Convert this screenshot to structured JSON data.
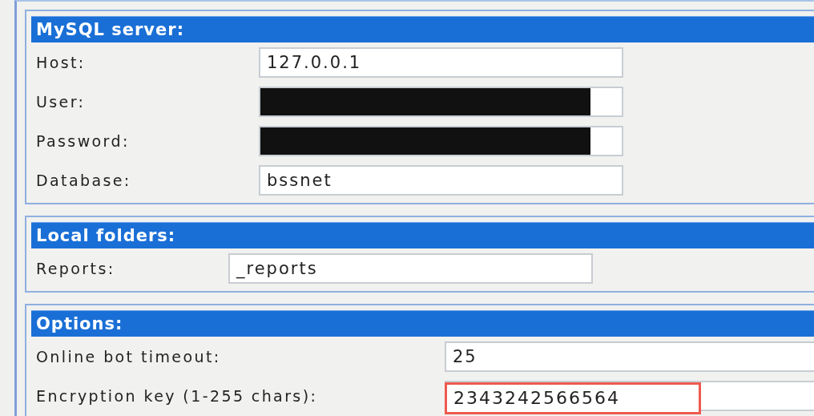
{
  "sections": [
    {
      "title": "MySQL server:",
      "fields": [
        {
          "label": "Host:",
          "value": "127.0.0.1",
          "redacted": false,
          "highlighted": false
        },
        {
          "label": "User:",
          "redacted": true,
          "highlighted": false
        },
        {
          "label": "Password:",
          "redacted": true,
          "highlighted": false
        },
        {
          "label": "Database:",
          "value": "bssnet",
          "redacted": false,
          "highlighted": false
        }
      ]
    },
    {
      "title": "Local folders:",
      "fields": [
        {
          "label": "Reports:",
          "value": "_reports",
          "redacted": false,
          "highlighted": false
        }
      ]
    },
    {
      "title": "Options:",
      "fields": [
        {
          "label": "Online bot timeout:",
          "value": "25",
          "redacted": false,
          "highlighted": false
        },
        {
          "label": "Encryption key (1-255 chars):",
          "value": "2343242566564",
          "redacted": false,
          "highlighted": true
        }
      ]
    }
  ]
}
